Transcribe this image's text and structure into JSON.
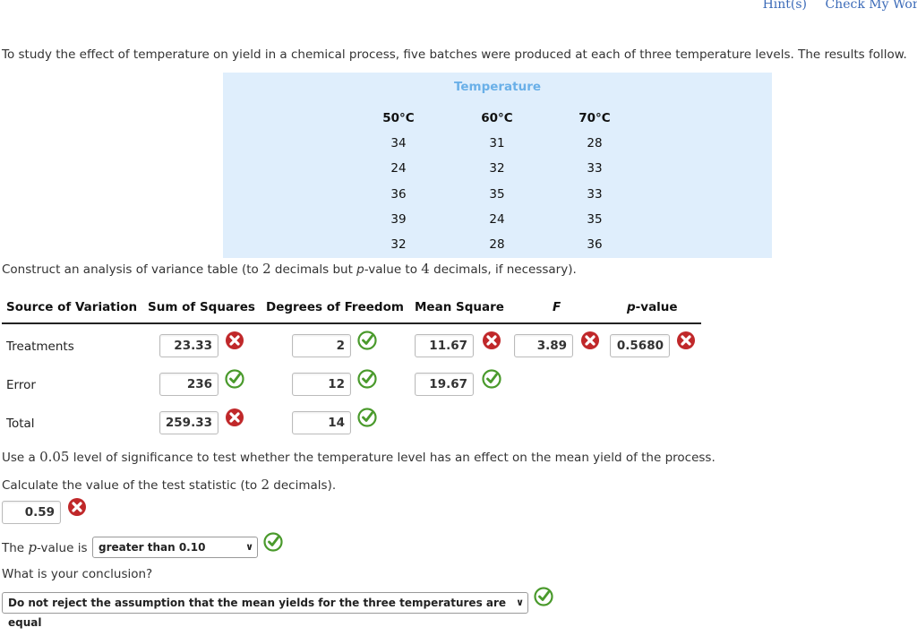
{
  "header": {
    "hints_link": "Hint(s)",
    "check_link": "Check My Work"
  },
  "intro_text": "To study the effect of temperature on yield in a chemical process, five batches were produced at each of three temperature levels. The results follow.",
  "data_table": {
    "title": "Temperature",
    "columns": [
      {
        "label": "50°C",
        "values": [
          "34",
          "24",
          "36",
          "39",
          "32"
        ]
      },
      {
        "label": "60°C",
        "values": [
          "31",
          "32",
          "35",
          "24",
          "28"
        ]
      },
      {
        "label": "70°C",
        "values": [
          "28",
          "33",
          "33",
          "35",
          "36"
        ]
      }
    ]
  },
  "construct": {
    "pre": "Construct an analysis of variance table (to ",
    "n1": "2",
    "mid1": " decimals but ",
    "p": "p",
    "mid2": "-value to ",
    "n2": "4",
    "post": " decimals, if necessary)."
  },
  "anova": {
    "headers": {
      "source": "Source of Variation",
      "ss": "Sum of Squares",
      "df": "Degrees of Freedom",
      "ms": "Mean Square",
      "f": "F",
      "p_italic": "p",
      "p_rest": "-value"
    },
    "rows": [
      {
        "label": "Treatments",
        "ss": {
          "value": "23.33",
          "status": "incorrect"
        },
        "df": {
          "value": "2",
          "status": "correct"
        },
        "ms": {
          "value": "11.67",
          "status": "incorrect"
        },
        "f": {
          "value": "3.89",
          "status": "incorrect"
        },
        "p": {
          "value": "0.5680",
          "status": "incorrect"
        }
      },
      {
        "label": "Error",
        "ss": {
          "value": "236",
          "status": "correct"
        },
        "df": {
          "value": "12",
          "status": "correct"
        },
        "ms": {
          "value": "19.67",
          "status": "correct"
        }
      },
      {
        "label": "Total",
        "ss": {
          "value": "259.33",
          "status": "incorrect"
        },
        "df": {
          "value": "14",
          "status": "correct"
        }
      }
    ]
  },
  "significance": {
    "pre": "Use a ",
    "alpha": "0.05",
    "post": " level of significance to test whether the temperature level has an effect on the mean yield of the process."
  },
  "test_stat": {
    "pre": "Calculate the value of the test statistic (to ",
    "n": "2",
    "post": " decimals).",
    "value": "0.59",
    "status": "incorrect"
  },
  "pvalue_q": {
    "pre": "The ",
    "p": "p",
    "post": "-value is",
    "selected": "greater than 0.10",
    "status": "correct"
  },
  "conclusion": {
    "question": "What is your conclusion?",
    "selected": "Do not reject the assumption that the mean yields for the three temperatures are equal",
    "status": "correct"
  },
  "colors": {
    "correct": "#4a9a2c",
    "incorrect": "#c0282a",
    "link": "#3c6bb8",
    "data_bg": "#dfeefc",
    "temp_title": "#6ab0e8"
  }
}
